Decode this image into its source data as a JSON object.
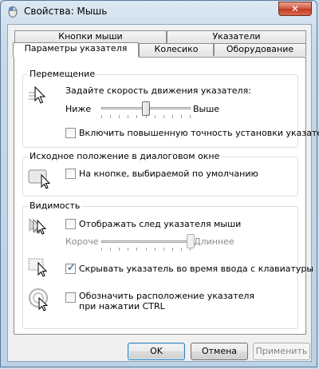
{
  "window": {
    "title": "Свойства: Мышь",
    "close_label": "✕"
  },
  "tabs": {
    "row1": [
      "Кнопки мыши",
      "Указатели"
    ],
    "row2": [
      "Параметры указателя",
      "Колесико",
      "Оборудование"
    ],
    "active": "Параметры указателя"
  },
  "motion": {
    "title": "Перемещение",
    "speed_label": "Задайте скорость движения указателя:",
    "slow_label": "Ниже",
    "fast_label": "Выше",
    "speed_level": 0.5,
    "precision_label": "Включить повышенную точность установки указателя",
    "precision_checked": false
  },
  "snap_to": {
    "title": "Исходное положение в диалоговом окне",
    "label": "На кнопке, выбираемой по умолчанию",
    "checked": false
  },
  "visibility": {
    "title": "Видимость",
    "trails_label": "Отображать след указателя мыши",
    "trails_checked": false,
    "short_label": "Короче",
    "long_label": "Длиннее",
    "trail_level": 1.0,
    "hide_label": "Скрывать указатель во время ввода с клавиатуры",
    "hide_checked": true,
    "show_location_label": "Обозначить расположение указателя при нажатии CTRL",
    "show_location_checked": false
  },
  "buttons": {
    "ok": "OK",
    "cancel": "Отмена",
    "apply": "Применить"
  },
  "icons": [
    "mouse-icon",
    "pointer-speed-icon",
    "snap-to-icon",
    "pointer-trails-icon",
    "hide-pointer-icon",
    "pointer-location-icon"
  ]
}
